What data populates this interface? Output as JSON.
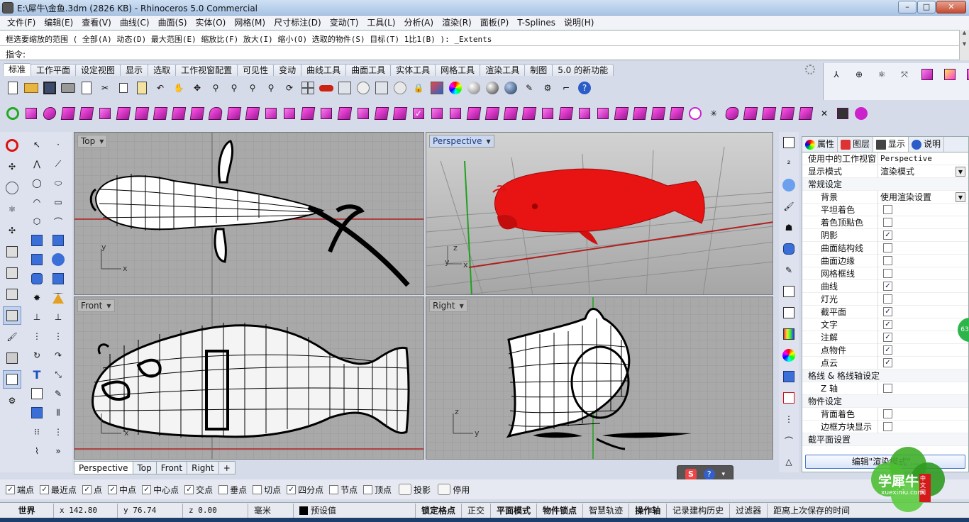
{
  "window": {
    "title": "E:\\犀牛\\金鱼.3dm (2826 KB) - Rhinoceros 5.0 Commercial",
    "min": "–",
    "max": "□",
    "close": "✕"
  },
  "menu": [
    "文件(F)",
    "编辑(E)",
    "查看(V)",
    "曲线(C)",
    "曲面(S)",
    "实体(O)",
    "网格(M)",
    "尺寸标注(D)",
    "变动(T)",
    "工具(L)",
    "分析(A)",
    "渲染(R)",
    "面板(P)",
    "T-Splines",
    "说明(H)"
  ],
  "command": {
    "history": "框选要缩放的范围 ( 全部(A)  动态(D)  最大范围(E)  缩放比(F)  放大(I)  缩小(O)  选取的物件(S)  目标(T)  1比1(B) ): _Extents",
    "prompt": "指令:"
  },
  "toolbar_tabs": [
    "标准",
    "工作平面",
    "设定视图",
    "显示",
    "选取",
    "工作视窗配置",
    "可见性",
    "变动",
    "曲线工具",
    "曲面工具",
    "实体工具",
    "网格工具",
    "渲染工具",
    "制图",
    "5.0 的新功能"
  ],
  "viewports": {
    "top": "Top",
    "perspective": "Perspective",
    "front": "Front",
    "right": "Right"
  },
  "axes": {
    "x": "x",
    "y": "y",
    "z": "z"
  },
  "viewport_tabs": [
    "Perspective",
    "Top",
    "Front",
    "Right"
  ],
  "viewport_tab_add": "+",
  "osnaps": [
    {
      "label": "端点",
      "checked": true
    },
    {
      "label": "最近点",
      "checked": true
    },
    {
      "label": "点",
      "checked": true
    },
    {
      "label": "中点",
      "checked": true
    },
    {
      "label": "中心点",
      "checked": true
    },
    {
      "label": "交点",
      "checked": true
    },
    {
      "label": "垂点",
      "checked": false
    },
    {
      "label": "切点",
      "checked": false
    },
    {
      "label": "四分点",
      "checked": true
    },
    {
      "label": "节点",
      "checked": false
    },
    {
      "label": "顶点",
      "checked": false
    }
  ],
  "osnap_buttons": [
    "投影",
    "停用"
  ],
  "status": {
    "world": "世界",
    "x": "x 142.80",
    "y": "y 76.74",
    "z": "z 0.00",
    "unit": "毫米",
    "layer": "预设值",
    "buttons": [
      "锁定格点",
      "正交",
      "平面模式",
      "物件锁点",
      "智慧轨迹",
      "操作轴",
      "记录建构历史",
      "过滤器"
    ],
    "message": "距离上次保存的时间"
  },
  "panel": {
    "tabs": [
      "属性",
      "图层",
      "显示",
      "说明"
    ],
    "rows": [
      {
        "label": "使用中的工作视窗",
        "value": "Perspective",
        "kind": "text"
      },
      {
        "label": "显示模式",
        "value": "渲染模式",
        "kind": "dropdown"
      },
      {
        "label": "常规设定",
        "kind": "section"
      },
      {
        "label": "背景",
        "value": "使用渲染设置",
        "kind": "dropdown",
        "indent": true
      },
      {
        "label": "平坦着色",
        "checked": false,
        "kind": "check",
        "indent": true
      },
      {
        "label": "着色顶點色",
        "checked": false,
        "kind": "check",
        "indent": true
      },
      {
        "label": "阴影",
        "checked": true,
        "kind": "check",
        "indent": true
      },
      {
        "label": "曲面结构线",
        "checked": false,
        "kind": "check",
        "indent": true
      },
      {
        "label": "曲面边缘",
        "checked": false,
        "kind": "check",
        "indent": true
      },
      {
        "label": "网格框线",
        "checked": false,
        "kind": "check",
        "indent": true
      },
      {
        "label": "曲线",
        "checked": true,
        "kind": "check",
        "indent": true
      },
      {
        "label": "灯光",
        "checked": false,
        "kind": "check",
        "indent": true
      },
      {
        "label": "截平面",
        "checked": true,
        "kind": "check",
        "indent": true
      },
      {
        "label": "文字",
        "checked": true,
        "kind": "check",
        "indent": true
      },
      {
        "label": "注解",
        "checked": true,
        "kind": "check",
        "indent": true
      },
      {
        "label": "点物件",
        "checked": true,
        "kind": "check",
        "indent": true
      },
      {
        "label": "点云",
        "checked": true,
        "kind": "check",
        "indent": true
      },
      {
        "label": "格线 & 格线轴设定",
        "kind": "section"
      },
      {
        "label": "Z 轴",
        "checked": false,
        "kind": "check",
        "indent": true
      },
      {
        "label": "物件设定",
        "kind": "section"
      },
      {
        "label": "背面着色",
        "checked": false,
        "kind": "check",
        "indent": true
      },
      {
        "label": "边框方块显示",
        "checked": false,
        "kind": "check",
        "indent": true
      },
      {
        "label": "截平面设置",
        "kind": "section"
      }
    ],
    "edit_button": "编辑\"渲染模式\"..."
  },
  "watermark": {
    "cn": "学犀牛",
    "site": "xuexiniu.com",
    "tag": "中文网"
  },
  "badge": "63",
  "colors": {
    "fish": "#e81313",
    "x_axis": "#b02020",
    "y_axis": "#20a020"
  }
}
